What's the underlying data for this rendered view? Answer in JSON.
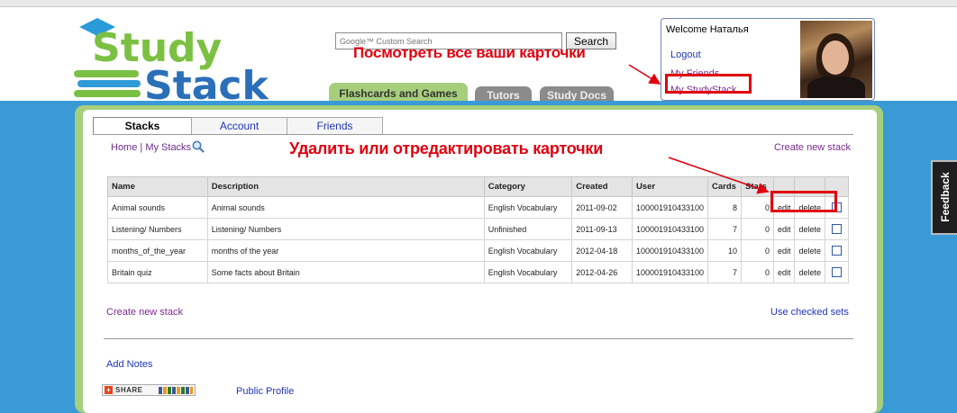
{
  "header": {
    "search": {
      "placeholder": "Google™ Custom Search",
      "button_label": "Search"
    },
    "nav_tabs": [
      {
        "label": "Flashcards and Games"
      },
      {
        "label": "Tutors"
      },
      {
        "label": "Study Docs"
      }
    ],
    "welcome": {
      "title": "Welcome Наталья",
      "links": [
        "Logout",
        "My Friends",
        "My StudyStack"
      ]
    }
  },
  "annotations": {
    "view_cards": "Посмотреть все ваши карточки",
    "edit_cards": "Удалить или отредактировать карточки"
  },
  "main": {
    "tabs": [
      "Stacks",
      "Account",
      "Friends"
    ],
    "breadcrumb": {
      "home": "Home",
      "sep": "|",
      "current": "My Stacks"
    },
    "create_top": "Create new stack",
    "table": {
      "headers": [
        "Name",
        "Description",
        "Category",
        "Created",
        "User",
        "Cards",
        "Stars"
      ],
      "rows": [
        {
          "name": "Animal sounds",
          "description": "Animal sounds",
          "category": "English Vocabulary",
          "created": "2011-09-02",
          "user": "100001910433100",
          "cards": "8",
          "stars": "0",
          "edit": "edit",
          "delete": "delete"
        },
        {
          "name": "Listening/ Numbers",
          "description": "Listening/ Numbers",
          "category": "Unfinished",
          "created": "2011-09-13",
          "user": "100001910433100",
          "cards": "7",
          "stars": "0",
          "edit": "edit",
          "delete": "delete"
        },
        {
          "name": "months_of_the_year",
          "description": "months of the year",
          "category": "English Vocabulary",
          "created": "2012-04-18",
          "user": "100001910433100",
          "cards": "10",
          "stars": "0",
          "edit": "edit",
          "delete": "delete"
        },
        {
          "name": "Britain quiz",
          "description": "Some facts about Britain",
          "category": "English Vocabulary",
          "created": "2012-04-26",
          "user": "100001910433100",
          "cards": "7",
          "stars": "0",
          "edit": "edit",
          "delete": "delete"
        }
      ]
    },
    "create_bottom": "Create new stack",
    "use_checked": "Use checked sets",
    "add_notes": "Add Notes",
    "share_label": "SHARE",
    "public_profile": "Public Profile"
  },
  "feedback_label": "Feedback",
  "colors": {
    "brand_blue": "#3a9ad6",
    "brand_green": "#a6cf7c",
    "annotation_red": "#e0000e",
    "link_purple": "#7b2a8e",
    "link_blue": "#2035b7"
  }
}
